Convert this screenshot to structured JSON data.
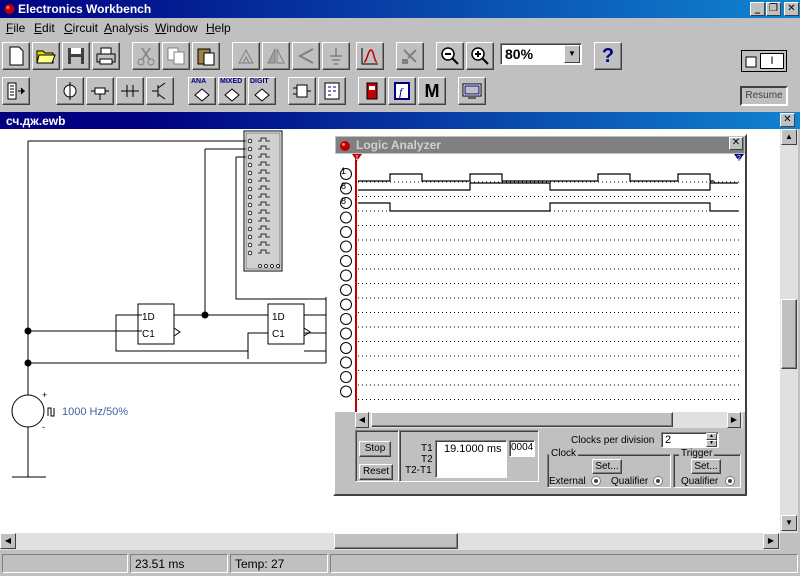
{
  "app": {
    "title": "Electronics Workbench"
  },
  "window_buttons": {
    "minimize": "_",
    "restore": "❐",
    "close": "✕"
  },
  "menu": [
    {
      "label": "File",
      "u": "F",
      "rest": "ile"
    },
    {
      "label": "Edit",
      "u": "E",
      "rest": "dit"
    },
    {
      "label": "Circuit",
      "u": "C",
      "rest": "ircuit"
    },
    {
      "label": "Analysis",
      "u": "A",
      "rest": "nalysis"
    },
    {
      "label": "Window",
      "u": "W",
      "rest": "indow"
    },
    {
      "label": "Help",
      "u": "H",
      "rest": "elp"
    }
  ],
  "toolbar": {
    "zoom_value": "80%",
    "help_label": "?",
    "power_label": "I",
    "resume_label": "Resume",
    "parts_bins": {
      "ana": "ANA",
      "mixed": "MIXED",
      "digit": "DIGIT",
      "meters": "M"
    }
  },
  "document": {
    "title": "сч.дж.ewb"
  },
  "circuit": {
    "source_label": "1000 Hz/50%",
    "ff1": {
      "d": "1D",
      "c": "C1"
    },
    "ff2": {
      "d": "1D",
      "c": "C1"
    },
    "plus": "+",
    "minus": "-"
  },
  "logic_analyzer": {
    "title": "Logic Analyzer",
    "channels_shown": 16,
    "channel_labels": [
      "1",
      "8",
      "8"
    ],
    "cursor1": "1",
    "cursor2": "2",
    "stop_label": "Stop",
    "reset_label": "Reset",
    "t1_label": "T1",
    "t2_label": "T2",
    "t2t1_label": "T2-T1",
    "t1_value": "19.1000 ms",
    "hex_value": "0004",
    "clocks_per_division_label": "Clocks per division",
    "clocks_per_division": "2",
    "clock_label": "Clock",
    "trigger_label": "Trigger",
    "set_label": "Set...",
    "external_label": "External",
    "qualifier_label": "Qualifier"
  },
  "status": {
    "time": "23.51 ms",
    "temp": "Temp:  27"
  }
}
